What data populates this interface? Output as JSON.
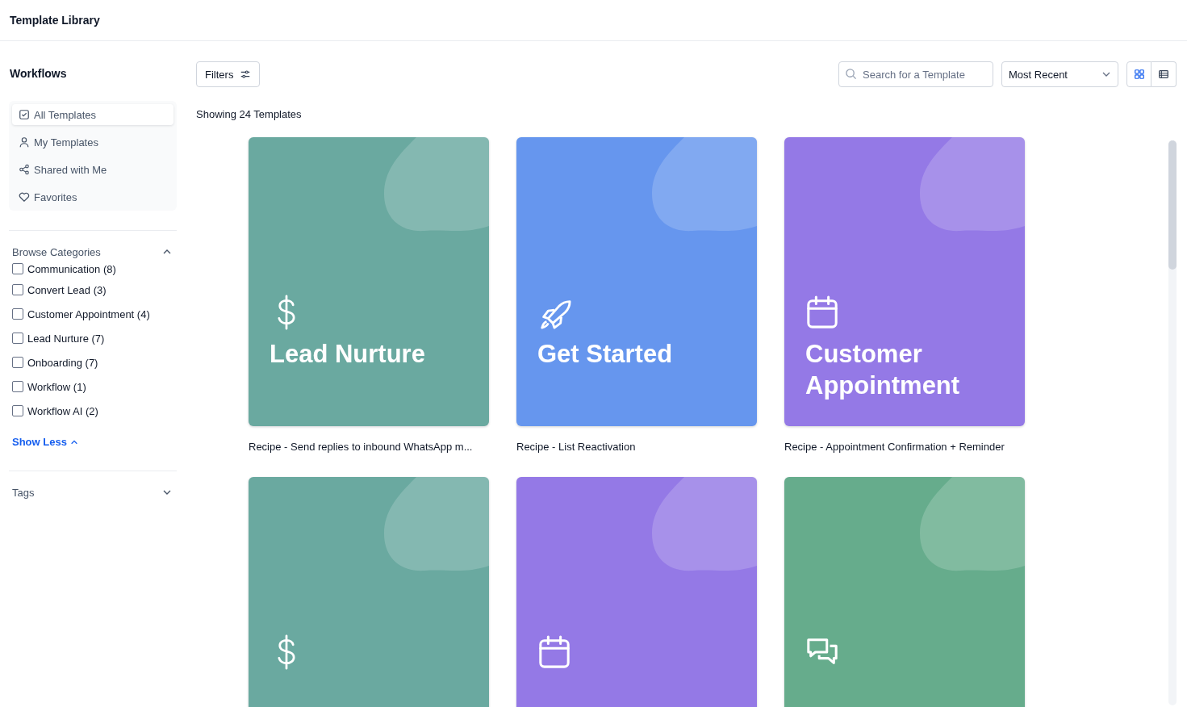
{
  "header": {
    "title": "Template Library"
  },
  "sidebar": {
    "title": "Workflows",
    "items": [
      {
        "label": "All Templates",
        "selected": true
      },
      {
        "label": "My Templates",
        "selected": false
      },
      {
        "label": "Shared with Me",
        "selected": false
      },
      {
        "label": "Favorites",
        "selected": false
      }
    ],
    "categories": {
      "title": "Browse Categories",
      "expanded": true,
      "items": [
        {
          "label": "Communication (8)",
          "checked": false
        },
        {
          "label": "Convert Lead (3)",
          "checked": false
        },
        {
          "label": "Customer Appointment (4)",
          "checked": false
        },
        {
          "label": "Lead Nurture (7)",
          "checked": false
        },
        {
          "label": "Onboarding (7)",
          "checked": false
        },
        {
          "label": "Workflow (1)",
          "checked": false
        },
        {
          "label": "Workflow AI (2)",
          "checked": false
        }
      ],
      "toggle": "Show Less"
    },
    "tags": {
      "title": "Tags",
      "expanded": false
    }
  },
  "toolbar": {
    "filters": "Filters",
    "search": {
      "placeholder": "Search for a Template"
    },
    "sort": "Most Recent",
    "view": [
      {
        "kind": "grid",
        "selected": true
      },
      {
        "kind": "list",
        "selected": false
      }
    ]
  },
  "count": "Showing 24 Templates",
  "cards": [
    {
      "kind": "dollar",
      "color": "#6aa9a0",
      "title": "Lead Nurture",
      "caption": "Recipe - Send replies to inbound WhatsApp m..."
    },
    {
      "kind": "rocket",
      "color": "#6696ee",
      "title": "Get Started",
      "caption": "Recipe - List Reactivation"
    },
    {
      "kind": "calendar",
      "color": "#9479e6",
      "title": "Customer Appointment",
      "caption": "Recipe - Appointment Confirmation + Reminder"
    },
    {
      "kind": "dollar",
      "color": "#6aa9a0"
    },
    {
      "kind": "calendar",
      "color": "#9479e6"
    },
    {
      "kind": "chat",
      "color": "#66ac8c"
    }
  ]
}
